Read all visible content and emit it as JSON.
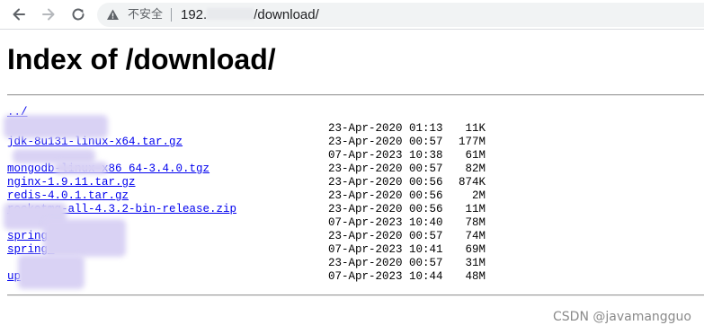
{
  "browser": {
    "security_label": "不安全",
    "url_prefix": "192.",
    "url_suffix": "/download/"
  },
  "page": {
    "title": "Index of /download/",
    "parent_link": "../"
  },
  "files": [
    {
      "name": "",
      "date": "23-Apr-2020 01:13",
      "size": "11K"
    },
    {
      "name": "jdk-8u131-linux-x64.tar.gz",
      "date": "23-Apr-2020 00:57",
      "size": "177M"
    },
    {
      "name": "",
      "date": "07-Apr-2023 10:38",
      "size": "61M"
    },
    {
      "name": "mongodb-linux-x86_64-3.4.0.tgz",
      "date": "23-Apr-2020 00:57",
      "size": "82M"
    },
    {
      "name": "nginx-1.9.11.tar.gz",
      "date": "23-Apr-2020 00:56",
      "size": "874K"
    },
    {
      "name": "redis-4.0.1.tar.gz",
      "date": "23-Apr-2020 00:56",
      "size": "2M"
    },
    {
      "name": "rocketmq-all-4.3.2-bin-release.zip",
      "date": "23-Apr-2020 00:56",
      "size": "11M"
    },
    {
      "name": "",
      "date": "07-Apr-2023 10:40",
      "size": "78M"
    },
    {
      "name": "spring-",
      "date": "23-Apr-2020 00:57",
      "size": "74M"
    },
    {
      "name": "spring-",
      "date": "07-Apr-2023 10:41",
      "size": "69M"
    },
    {
      "name": "",
      "date": "23-Apr-2020 00:57",
      "size": "31M"
    },
    {
      "name": "up",
      "date": "07-Apr-2023 10:44",
      "size": "48M"
    }
  ],
  "icons": {
    "back": "arrow-left-icon",
    "forward": "arrow-right-icon",
    "reload": "reload-icon",
    "security": "warning-triangle-icon"
  },
  "watermark": "CSDN @javamangguo"
}
